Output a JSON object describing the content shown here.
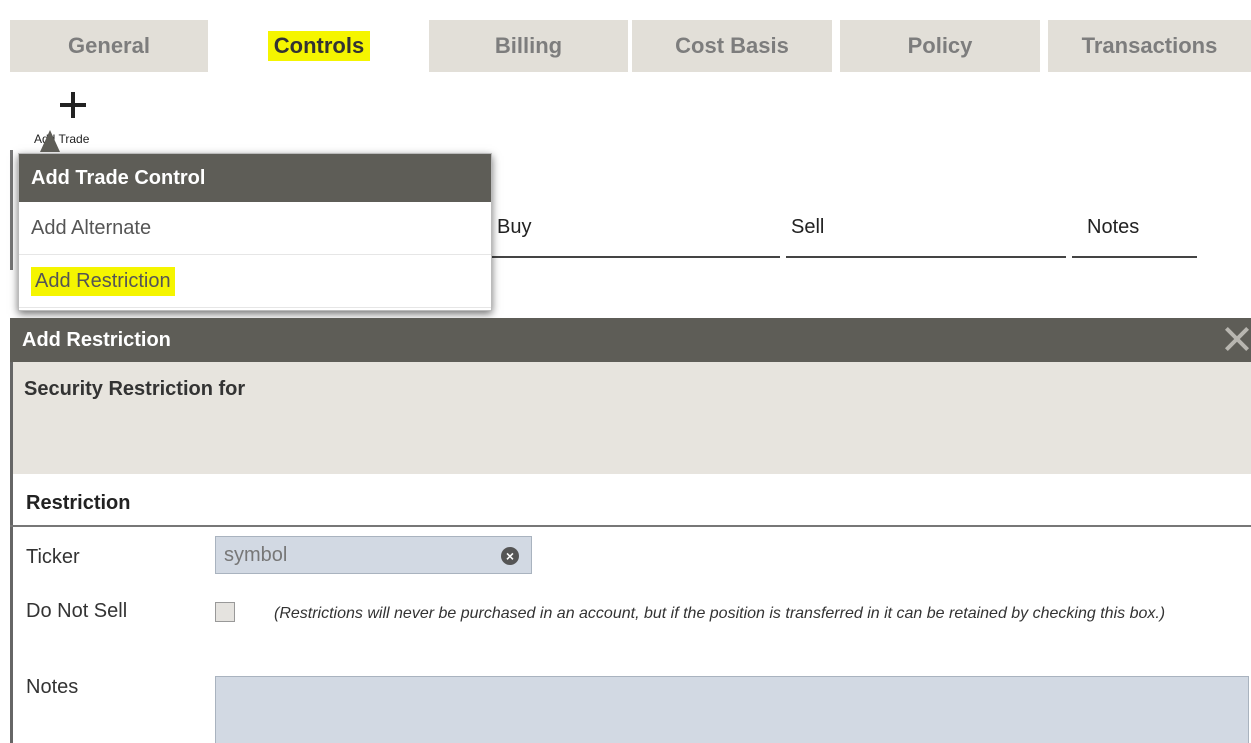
{
  "tabs": [
    {
      "label": "General",
      "active": false
    },
    {
      "label": "Controls",
      "active": true
    },
    {
      "label": "Billing",
      "active": false
    },
    {
      "label": "Cost Basis",
      "active": false
    },
    {
      "label": "Policy",
      "active": false
    },
    {
      "label": "Transactions",
      "active": false
    }
  ],
  "toolbar": {
    "add_trade_label": "Add Trade",
    "add_trade_icon": "plus-icon"
  },
  "table_columns": [
    "Buy",
    "Sell",
    "Notes"
  ],
  "menu": {
    "header": "Add Trade Control",
    "items": [
      "Add Alternate",
      "Add Restriction"
    ]
  },
  "dialog": {
    "title": "Add Restriction",
    "subtitle": "Security Restriction for",
    "section_title": "Restriction",
    "ticker": {
      "label": "Ticker",
      "placeholder": "symbol",
      "value": ""
    },
    "do_not_sell": {
      "label": "Do Not Sell",
      "checked": false,
      "hint": "(Restrictions will never be purchased in an account, but if the position is transferred in it can be retained by checking this box.)"
    },
    "notes": {
      "label": "Notes",
      "value": ""
    }
  },
  "colors": {
    "tab_bg": "#e2dfd8",
    "header_bg": "#5e5d57",
    "highlight": "#f5f500",
    "input_bg": "#d2d9e3",
    "subtitle_bg": "#e7e4de"
  }
}
